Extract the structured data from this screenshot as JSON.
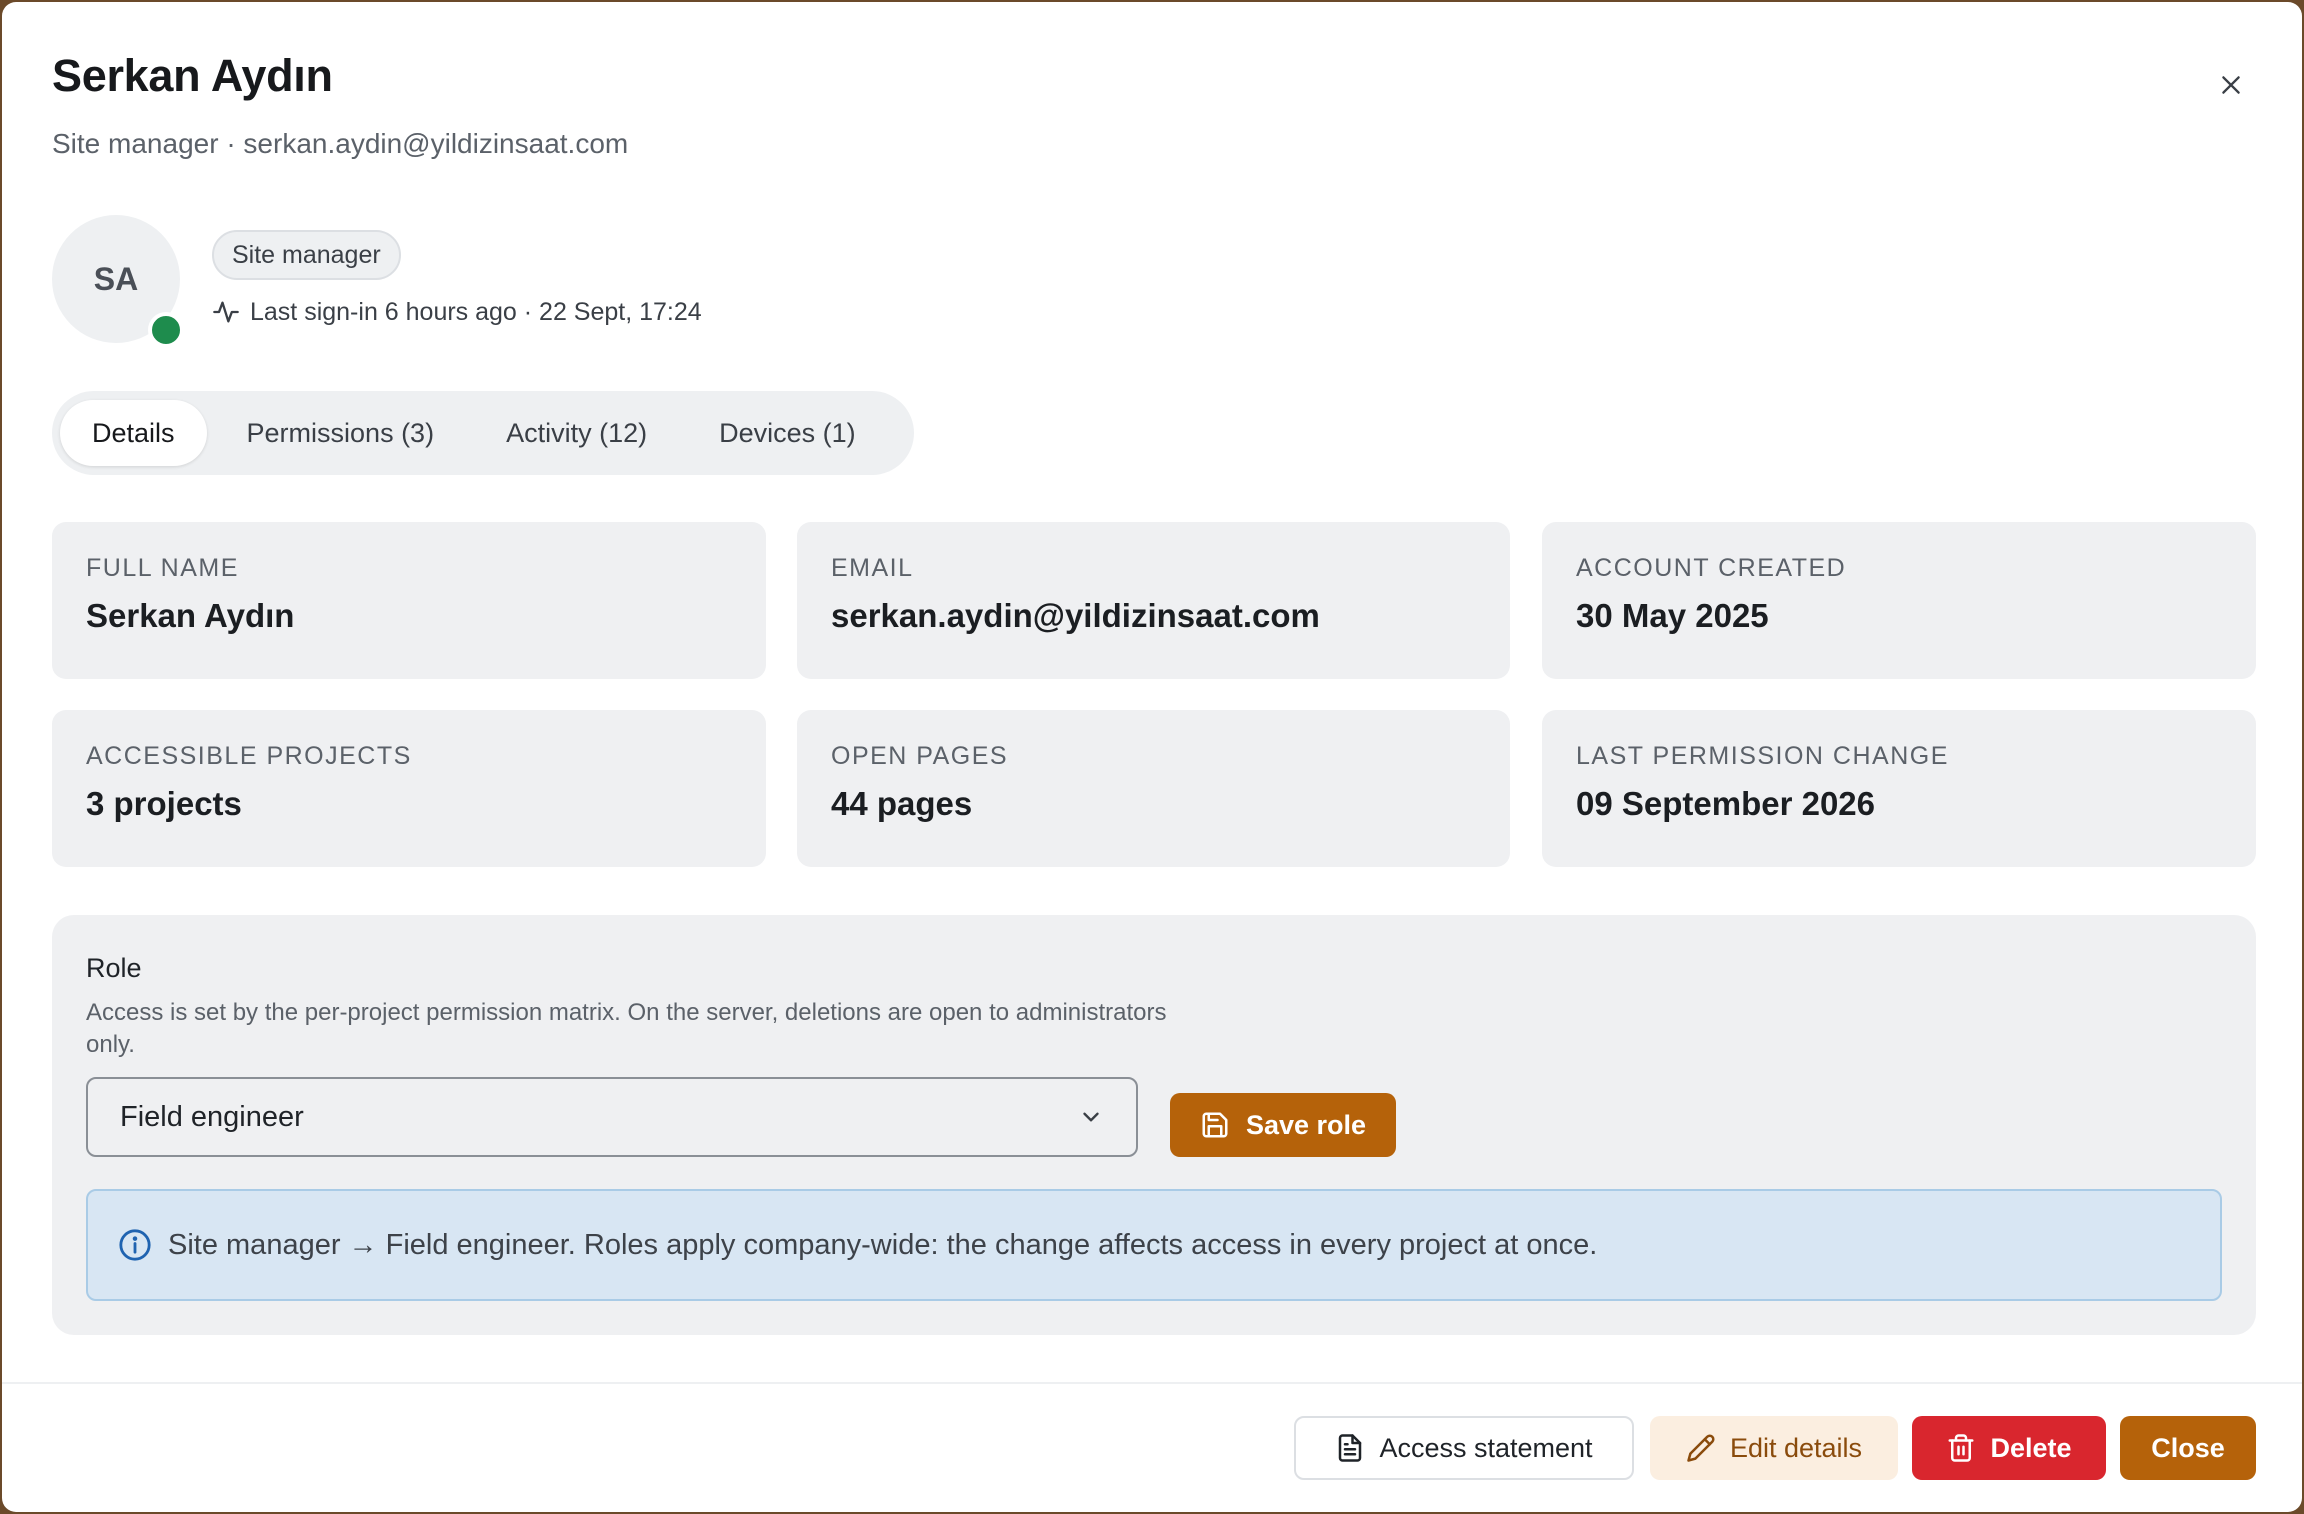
{
  "header": {
    "title": "Serkan Aydın",
    "subtitle": "Site manager · serkan.aydin@yildizinsaat.com"
  },
  "profile": {
    "initials": "SA",
    "status": "online",
    "role_badge": "Site manager",
    "last_signin": "Last sign-in 6 hours ago · 22 Sept, 17:24",
    "icons": {
      "activity": "activity-pulse-icon",
      "close": "close-icon"
    }
  },
  "tabs": [
    {
      "label": "Details",
      "active": true
    },
    {
      "label": "Permissions (3)",
      "active": false
    },
    {
      "label": "Activity (12)",
      "active": false
    },
    {
      "label": "Devices (1)",
      "active": false
    }
  ],
  "details": [
    {
      "label": "FULL NAME",
      "value": "Serkan Aydın"
    },
    {
      "label": "EMAIL",
      "value": "serkan.aydin@yildizinsaat.com"
    },
    {
      "label": "ACCOUNT CREATED",
      "value": "30 May 2025"
    },
    {
      "label": "ACCESSIBLE PROJECTS",
      "value": "3 projects"
    },
    {
      "label": "OPEN PAGES",
      "value": "44 pages"
    },
    {
      "label": "LAST PERMISSION CHANGE",
      "value": "09 September 2026"
    }
  ],
  "role": {
    "title": "Role",
    "description": "Access is set by the per-project permission matrix. On the server, deletions are open to administrators only.",
    "selected": "Field engineer",
    "save_label": "Save role",
    "info": "Site manager → Field engineer. Roles apply company-wide: the change affects access in every project at once."
  },
  "footer": {
    "access_statement": "Access statement",
    "edit_details": "Edit details",
    "delete": "Delete",
    "close": "Close"
  },
  "colors": {
    "accent": "#b5620a",
    "danger": "#d9262e",
    "online": "#1e8c4d",
    "info_bg": "#d8e6f3"
  }
}
